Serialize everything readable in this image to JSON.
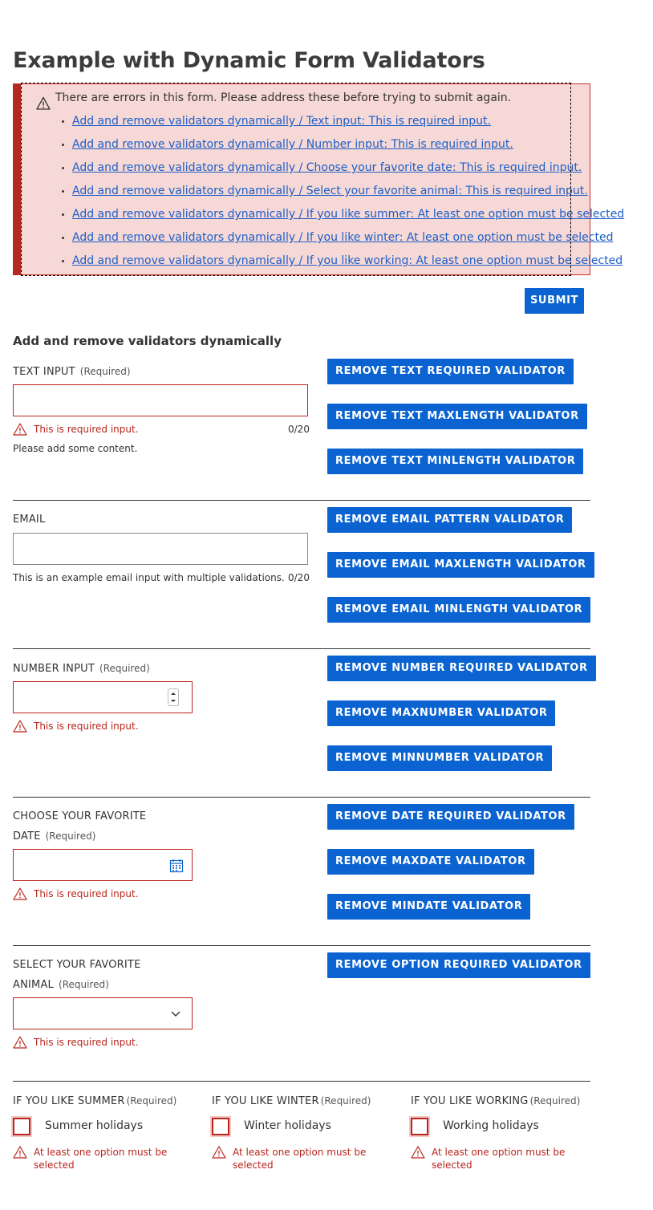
{
  "page": {
    "title": "Example with Dynamic Form Validators"
  },
  "error_summary": {
    "title": "There are errors in this form. Please address these before trying to submit again.",
    "items": [
      "Add and remove validators dynamically / Text input: This is required input.",
      "Add and remove validators dynamically / Number input: This is required input.",
      "Add and remove validators dynamically / Choose your favorite date: This is required input.",
      "Add and remove validators dynamically / Select your favorite animal: This is required input.",
      "Add and remove validators dynamically / If you like summer: At least one option must be selected",
      "Add and remove validators dynamically / If you like winter: At least one option must be selected",
      "Add and remove validators dynamically / If you like working: At least one option must be selected"
    ]
  },
  "submit_label": "SUBMIT",
  "section": {
    "heading": "Add and remove validators dynamically"
  },
  "required_tag": "(Required)",
  "text_input": {
    "label": "TEXT INPUT",
    "value": "",
    "error": "This is required input.",
    "counter": "0/20",
    "hint": "Please add some content.",
    "buttons": [
      "REMOVE TEXT REQUIRED VALIDATOR",
      "REMOVE TEXT MAXLENGTH VALIDATOR",
      "REMOVE TEXT MINLENGTH VALIDATOR"
    ]
  },
  "email": {
    "label": "EMAIL",
    "value": "",
    "hint": "This is an example email input with multiple validations.",
    "counter": "0/20",
    "buttons": [
      "REMOVE EMAIL PATTERN VALIDATOR",
      "REMOVE EMAIL MAXLENGTH VALIDATOR",
      "REMOVE EMAIL MINLENGTH VALIDATOR"
    ]
  },
  "number_input": {
    "label": "NUMBER INPUT",
    "value": "",
    "error": "This is required input.",
    "buttons": [
      "REMOVE NUMBER REQUIRED VALIDATOR",
      "REMOVE MAXNUMBER VALIDATOR",
      "REMOVE MINNUMBER VALIDATOR"
    ]
  },
  "date_input": {
    "label_line1": "CHOOSE YOUR FAVORITE",
    "label_line2": "DATE",
    "value": "",
    "error": "This is required input.",
    "buttons": [
      "REMOVE DATE REQUIRED VALIDATOR",
      "REMOVE MAXDATE VALIDATOR",
      "REMOVE MINDATE VALIDATOR"
    ]
  },
  "animal_select": {
    "label_line1": "SELECT YOUR FAVORITE",
    "label_line2": "ANIMAL",
    "value": "",
    "error": "This is required input.",
    "buttons": [
      "REMOVE OPTION REQUIRED VALIDATOR"
    ]
  },
  "checkbox_groups": [
    {
      "label": "IF YOU LIKE SUMMER",
      "option": "Summer holidays",
      "checked": false,
      "error": "At least one option must be selected"
    },
    {
      "label": "IF YOU LIKE WINTER",
      "option": "Winter holidays",
      "checked": false,
      "error": "At least one option must be selected"
    },
    {
      "label": "IF YOU LIKE WORKING",
      "option": "Working holidays",
      "checked": false,
      "error": "At least one option must be selected"
    }
  ],
  "colors": {
    "accent": "#0a63d1",
    "error": "#b8251d",
    "error_bg": "#f6d9d6",
    "link": "#1d5ec8"
  },
  "icons": {
    "warning": "warning-triangle-icon",
    "calendar": "calendar-icon",
    "select": "chevron-down-icon",
    "spinner": "number-spinner-icon"
  }
}
